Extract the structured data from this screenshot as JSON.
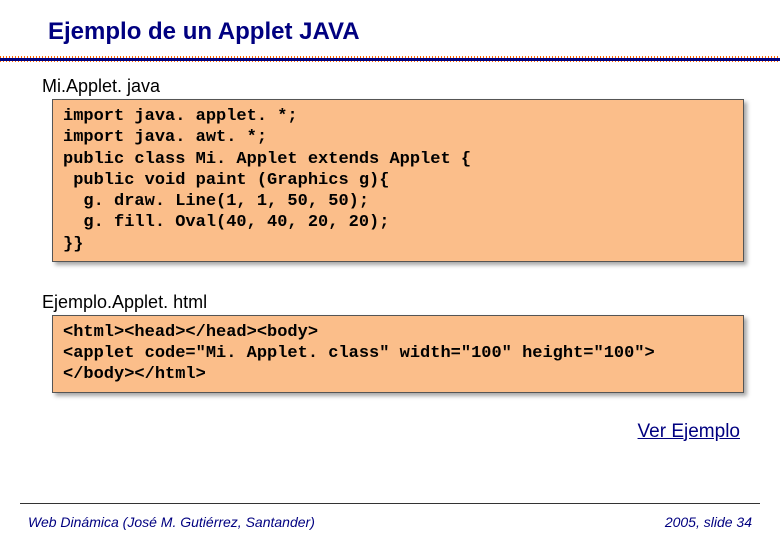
{
  "title": "Ejemplo de un Applet JAVA",
  "file1": {
    "name": "Mi.Applet. java"
  },
  "code1": "import java. applet. *;\nimport java. awt. *;\npublic class Mi. Applet extends Applet {\n public void paint (Graphics g){\n  g. draw. Line(1, 1, 50, 50);\n  g. fill. Oval(40, 40, 20, 20);\n}}",
  "file2": {
    "name": "Ejemplo.Applet. html"
  },
  "code2": "<html><head></head><body>\n<applet code=\"Mi. Applet. class\" width=\"100\" height=\"100\">\n</body></html>",
  "link": {
    "label": "Ver Ejemplo"
  },
  "footer": {
    "left": "Web Dinámica (José M. Gutiérrez, Santander)",
    "right": "2005, slide 34"
  }
}
